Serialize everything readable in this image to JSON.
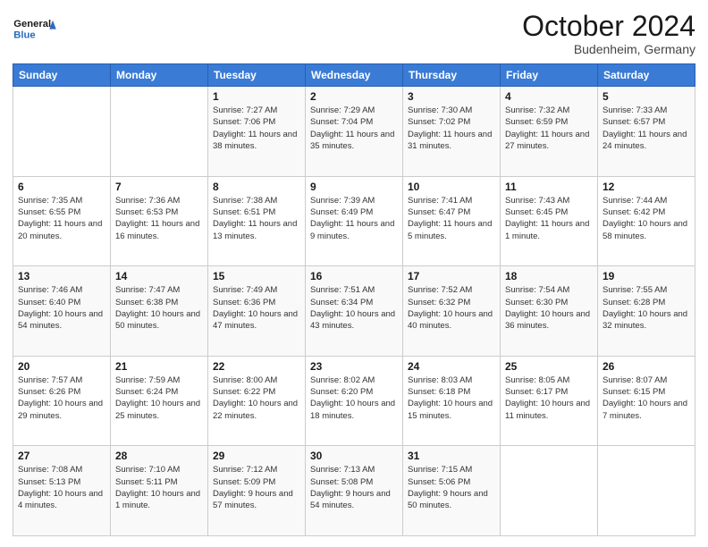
{
  "logo": {
    "line1": "General",
    "line2": "Blue"
  },
  "header": {
    "month": "October 2024",
    "location": "Budenheim, Germany"
  },
  "weekdays": [
    "Sunday",
    "Monday",
    "Tuesday",
    "Wednesday",
    "Thursday",
    "Friday",
    "Saturday"
  ],
  "weeks": [
    [
      {
        "day": "",
        "info": ""
      },
      {
        "day": "",
        "info": ""
      },
      {
        "day": "1",
        "info": "Sunrise: 7:27 AM\nSunset: 7:06 PM\nDaylight: 11 hours and 38 minutes."
      },
      {
        "day": "2",
        "info": "Sunrise: 7:29 AM\nSunset: 7:04 PM\nDaylight: 11 hours and 35 minutes."
      },
      {
        "day": "3",
        "info": "Sunrise: 7:30 AM\nSunset: 7:02 PM\nDaylight: 11 hours and 31 minutes."
      },
      {
        "day": "4",
        "info": "Sunrise: 7:32 AM\nSunset: 6:59 PM\nDaylight: 11 hours and 27 minutes."
      },
      {
        "day": "5",
        "info": "Sunrise: 7:33 AM\nSunset: 6:57 PM\nDaylight: 11 hours and 24 minutes."
      }
    ],
    [
      {
        "day": "6",
        "info": "Sunrise: 7:35 AM\nSunset: 6:55 PM\nDaylight: 11 hours and 20 minutes."
      },
      {
        "day": "7",
        "info": "Sunrise: 7:36 AM\nSunset: 6:53 PM\nDaylight: 11 hours and 16 minutes."
      },
      {
        "day": "8",
        "info": "Sunrise: 7:38 AM\nSunset: 6:51 PM\nDaylight: 11 hours and 13 minutes."
      },
      {
        "day": "9",
        "info": "Sunrise: 7:39 AM\nSunset: 6:49 PM\nDaylight: 11 hours and 9 minutes."
      },
      {
        "day": "10",
        "info": "Sunrise: 7:41 AM\nSunset: 6:47 PM\nDaylight: 11 hours and 5 minutes."
      },
      {
        "day": "11",
        "info": "Sunrise: 7:43 AM\nSunset: 6:45 PM\nDaylight: 11 hours and 1 minute."
      },
      {
        "day": "12",
        "info": "Sunrise: 7:44 AM\nSunset: 6:42 PM\nDaylight: 10 hours and 58 minutes."
      }
    ],
    [
      {
        "day": "13",
        "info": "Sunrise: 7:46 AM\nSunset: 6:40 PM\nDaylight: 10 hours and 54 minutes."
      },
      {
        "day": "14",
        "info": "Sunrise: 7:47 AM\nSunset: 6:38 PM\nDaylight: 10 hours and 50 minutes."
      },
      {
        "day": "15",
        "info": "Sunrise: 7:49 AM\nSunset: 6:36 PM\nDaylight: 10 hours and 47 minutes."
      },
      {
        "day": "16",
        "info": "Sunrise: 7:51 AM\nSunset: 6:34 PM\nDaylight: 10 hours and 43 minutes."
      },
      {
        "day": "17",
        "info": "Sunrise: 7:52 AM\nSunset: 6:32 PM\nDaylight: 10 hours and 40 minutes."
      },
      {
        "day": "18",
        "info": "Sunrise: 7:54 AM\nSunset: 6:30 PM\nDaylight: 10 hours and 36 minutes."
      },
      {
        "day": "19",
        "info": "Sunrise: 7:55 AM\nSunset: 6:28 PM\nDaylight: 10 hours and 32 minutes."
      }
    ],
    [
      {
        "day": "20",
        "info": "Sunrise: 7:57 AM\nSunset: 6:26 PM\nDaylight: 10 hours and 29 minutes."
      },
      {
        "day": "21",
        "info": "Sunrise: 7:59 AM\nSunset: 6:24 PM\nDaylight: 10 hours and 25 minutes."
      },
      {
        "day": "22",
        "info": "Sunrise: 8:00 AM\nSunset: 6:22 PM\nDaylight: 10 hours and 22 minutes."
      },
      {
        "day": "23",
        "info": "Sunrise: 8:02 AM\nSunset: 6:20 PM\nDaylight: 10 hours and 18 minutes."
      },
      {
        "day": "24",
        "info": "Sunrise: 8:03 AM\nSunset: 6:18 PM\nDaylight: 10 hours and 15 minutes."
      },
      {
        "day": "25",
        "info": "Sunrise: 8:05 AM\nSunset: 6:17 PM\nDaylight: 10 hours and 11 minutes."
      },
      {
        "day": "26",
        "info": "Sunrise: 8:07 AM\nSunset: 6:15 PM\nDaylight: 10 hours and 7 minutes."
      }
    ],
    [
      {
        "day": "27",
        "info": "Sunrise: 7:08 AM\nSunset: 5:13 PM\nDaylight: 10 hours and 4 minutes."
      },
      {
        "day": "28",
        "info": "Sunrise: 7:10 AM\nSunset: 5:11 PM\nDaylight: 10 hours and 1 minute."
      },
      {
        "day": "29",
        "info": "Sunrise: 7:12 AM\nSunset: 5:09 PM\nDaylight: 9 hours and 57 minutes."
      },
      {
        "day": "30",
        "info": "Sunrise: 7:13 AM\nSunset: 5:08 PM\nDaylight: 9 hours and 54 minutes."
      },
      {
        "day": "31",
        "info": "Sunrise: 7:15 AM\nSunset: 5:06 PM\nDaylight: 9 hours and 50 minutes."
      },
      {
        "day": "",
        "info": ""
      },
      {
        "day": "",
        "info": ""
      }
    ]
  ]
}
